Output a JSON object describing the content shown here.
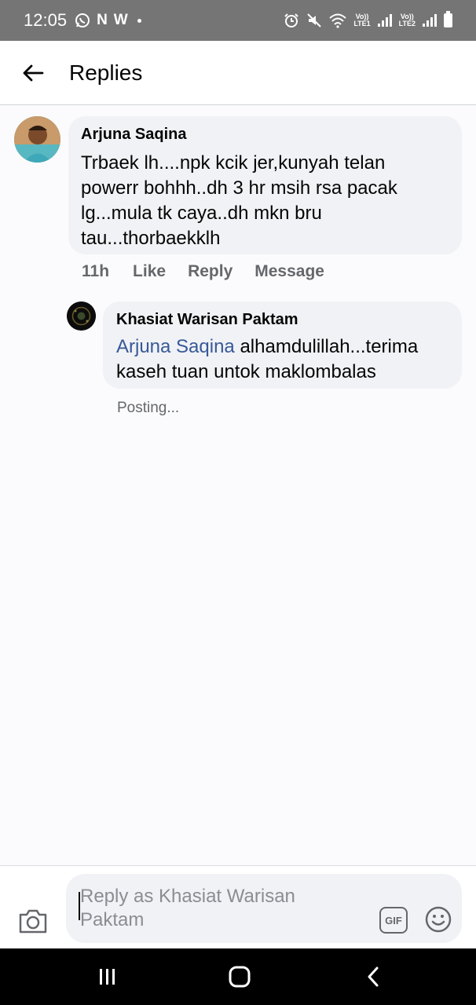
{
  "status_bar": {
    "time": "12:05",
    "left_icons": [
      "whatsapp-icon",
      "n-icon",
      "w-icon",
      "dot-icon"
    ],
    "n_label": "N",
    "w_label": "W",
    "lte1_top": "Vo))",
    "lte1_bottom": "LTE1",
    "lte2_top": "Vo))",
    "lte2_bottom": "LTE2"
  },
  "header": {
    "title": "Replies"
  },
  "comment": {
    "author": "Arjuna Saqina",
    "text": "Trbaek lh....npk kcik jer,kunyah telan powerr bohhh..dh 3 hr msih rsa pacak lg...mula tk caya..dh mkn bru tau...thorbaekklh",
    "time": "11h",
    "like_label": "Like",
    "reply_label": "Reply",
    "message_label": "Message"
  },
  "reply": {
    "author": "Khasiat Warisan Paktam",
    "mention": "Arjuna Saqina",
    "text": " alhamdulillah...terima kaseh tuan untok maklombalas",
    "status": "Posting..."
  },
  "composer": {
    "placeholder": "Reply as Khasiat Warisan Paktam",
    "gif_label": "GIF"
  },
  "colors": {
    "status_bar": "#757575",
    "bubble": "#f0f2f5",
    "mention": "#385898",
    "secondary_text": "#65676b",
    "nav_bar": "#000000"
  }
}
